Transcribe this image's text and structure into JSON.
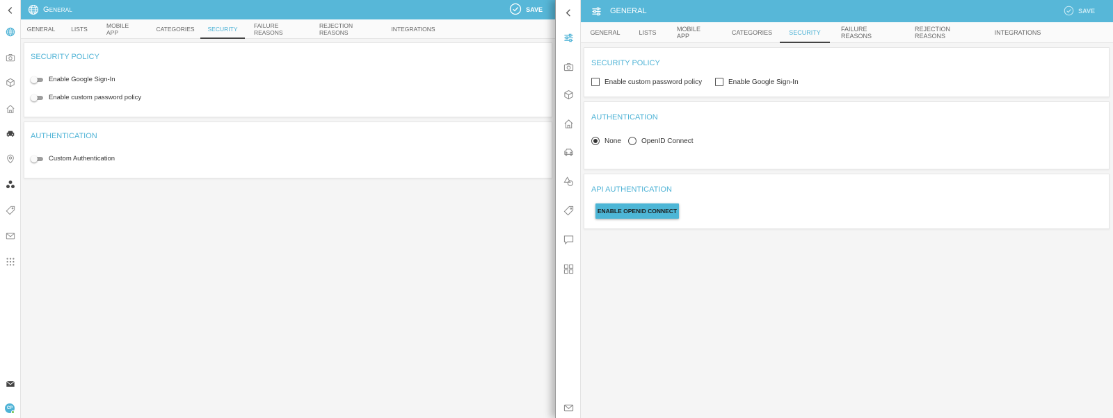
{
  "left": {
    "header": {
      "title": "General",
      "save_label": "SAVE"
    },
    "tabs": [
      {
        "label": "General"
      },
      {
        "label": "Lists"
      },
      {
        "label": "Mobile App"
      },
      {
        "label": "Categories"
      },
      {
        "label": "Security",
        "active": true
      },
      {
        "label": "Failure Reasons"
      },
      {
        "label": "Rejection Reasons"
      },
      {
        "label": "Integrations"
      }
    ],
    "security_policy": {
      "title": "Security Policy",
      "options": [
        {
          "label": "Enable Google Sign-In",
          "on": false
        },
        {
          "label": "Enable custom password policy",
          "on": false
        }
      ]
    },
    "authentication": {
      "title": "Authentication",
      "options": [
        {
          "label": "Custom Authentication",
          "on": false
        }
      ]
    },
    "avatar_initials": "CP"
  },
  "right": {
    "header": {
      "title": "GENERAL",
      "save_label": "SAVE"
    },
    "tabs": [
      {
        "label": "General"
      },
      {
        "label": "Lists"
      },
      {
        "label": "Mobile App"
      },
      {
        "label": "Categories"
      },
      {
        "label": "Security",
        "active": true
      },
      {
        "label": "Failure Reasons"
      },
      {
        "label": "Rejection Reasons"
      },
      {
        "label": "Integrations"
      }
    ],
    "security_policy": {
      "title": "Security Policy",
      "options": [
        {
          "label": "Enable custom password policy",
          "checked": false
        },
        {
          "label": "Enable Google Sign-In",
          "checked": false
        }
      ]
    },
    "authentication": {
      "title": "Authentication",
      "options": [
        {
          "label": "None",
          "selected": true
        },
        {
          "label": "OpenID Connect",
          "selected": false
        }
      ]
    },
    "api_authentication": {
      "title": "API Authentication",
      "button_label": "ENABLE OPENID CONNECT"
    }
  },
  "colors": {
    "accent": "#57b7d8",
    "title": "#4fb3d6",
    "background": "#f5f5f5"
  }
}
